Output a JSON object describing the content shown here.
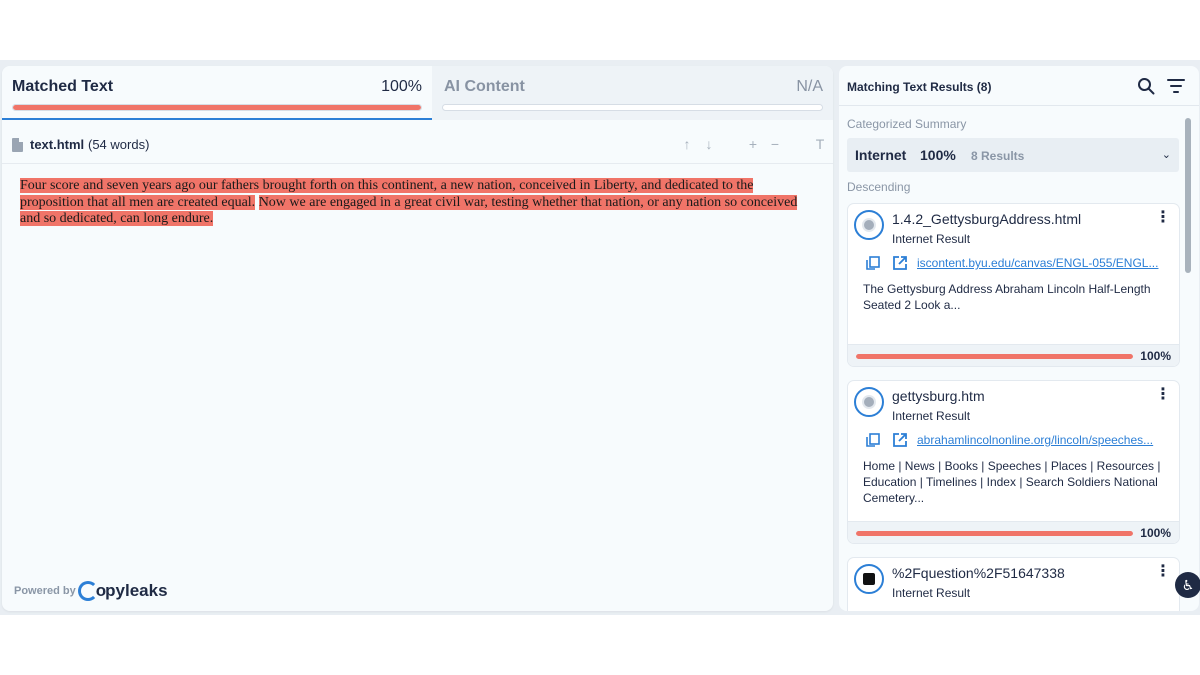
{
  "tabs": [
    {
      "label": "Matched Text",
      "value": "100%",
      "progress": 1.0
    },
    {
      "label": "AI Content",
      "value": "N/A",
      "progress": 0
    }
  ],
  "file": {
    "name": "text.html",
    "words": "(54 words)"
  },
  "toolbar_icons": [
    "arrow-up-icon",
    "arrow-down-icon",
    "plus-icon",
    "minus-icon",
    "text-size-icon"
  ],
  "document": {
    "highlighted_1": "Four score and seven years ago our fathers brought forth on this continent, a new nation, conceived in Liberty, and dedicated to the proposition that all men are created equal.",
    "highlighted_2": "Now we are engaged in a great civil war, testing whether that nation, or any nation so conceived and so dedicated, can long endure."
  },
  "powered_by": {
    "label": "Powered by",
    "brand_rest": "pyleaks"
  },
  "results": {
    "title": "Matching Text Results (8)",
    "categorized_label": "Categorized Summary",
    "summary": {
      "source": "Internet",
      "percent": "100%",
      "count": "8 Results"
    },
    "sort_label": "Descending",
    "items": [
      {
        "title": "1.4.2_GettysburgAddress.html",
        "type": "Internet Result",
        "url": "iscontent.byu.edu/canvas/ENGL-055/ENGL...",
        "snippet": "The Gettysburg Address Abraham Lincoln Half-Length Seated 2 Look a...",
        "percent": "100%",
        "progress": 1.0
      },
      {
        "title": "gettysburg.htm",
        "type": "Internet Result",
        "url": "abrahamlincolnonline.org/lincoln/speeches...",
        "snippet": "Home | News | Books | Speeches | Places | Resources | Education | Timelines | Index | Search Soldiers National Cemetery...",
        "percent": "100%",
        "progress": 1.0
      },
      {
        "title": "%2Fquestion%2F51647338",
        "type": "Internet Result"
      }
    ]
  },
  "colors": {
    "accent": "#2c7fd6",
    "match": "#f07468",
    "text": "#1f2a44"
  }
}
